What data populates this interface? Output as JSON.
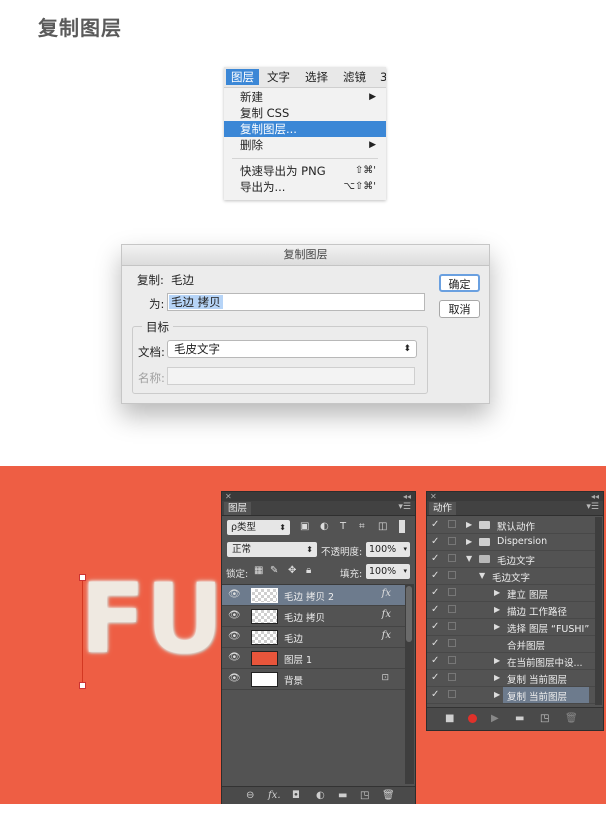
{
  "heading": "复制图层",
  "menu": {
    "bar": [
      "图层",
      "文字",
      "选择",
      "滤镜",
      "3"
    ],
    "items": [
      {
        "label": "新建",
        "shortcut": "",
        "arrow": "▶"
      },
      {
        "label": "复制 CSS",
        "shortcut": "",
        "arrow": ""
      },
      {
        "label": "复制图层...",
        "shortcut": "",
        "arrow": ""
      },
      {
        "label": "删除",
        "shortcut": "",
        "arrow": "▶"
      },
      {
        "label": "快速导出为 PNG",
        "shortcut": "⇧⌘'",
        "arrow": ""
      },
      {
        "label": "导出为...",
        "shortcut": "⌥⇧⌘'",
        "arrow": ""
      }
    ]
  },
  "dialog": {
    "title": "复制图层",
    "copy_label": "复制:",
    "copy_value": "毛边",
    "as_label": "为:",
    "as_value": "毛边 拷贝",
    "ok": "确定",
    "cancel": "取消",
    "target_label": "目标",
    "doc_label": "文档:",
    "doc_value": "毛皮文字",
    "name_label": "名称:",
    "name_value": ""
  },
  "canvas": {
    "background_color": "#ee5e44",
    "fur_text": "FU"
  },
  "layers_panel": {
    "tab": "图层",
    "filter_label": "ρ类型",
    "blend_mode": "正常",
    "opacity_label": "不透明度:",
    "opacity_value": "100%",
    "lock_label": "锁定:",
    "fill_label": "填充:",
    "fill_value": "100%",
    "layers": [
      {
        "name": "毛边 拷贝 2",
        "thumb": "checker",
        "fx": "fx",
        "selected": true
      },
      {
        "name": "毛边 拷贝",
        "thumb": "checker",
        "fx": "fx",
        "selected": false
      },
      {
        "name": "毛边",
        "thumb": "checker",
        "fx": "fx",
        "selected": false
      },
      {
        "name": "图层 1",
        "thumb": "#e8553b",
        "fx": "",
        "selected": false
      },
      {
        "name": "背景",
        "thumb": "#ffffff",
        "fx": "",
        "selected": false
      }
    ],
    "bottom_icons": [
      "link-icon",
      "fx-icon",
      "mask-icon",
      "adjustment-icon",
      "folder-icon",
      "new-layer-icon",
      "trash-icon"
    ],
    "bottom_fx": "fx."
  },
  "actions_panel": {
    "tab": "动作",
    "rows": [
      {
        "label": "默认动作",
        "level": 0,
        "expanded": false,
        "folder": true,
        "highlight": false
      },
      {
        "label": "Dispersion",
        "level": 0,
        "expanded": false,
        "folder": true,
        "highlight": false
      },
      {
        "label": "毛边文字",
        "level": 0,
        "expanded": true,
        "folder": true,
        "highlight": false
      },
      {
        "label": "毛边文字",
        "level": 1,
        "expanded": true,
        "folder": false,
        "highlight": false
      },
      {
        "label": "建立 图层",
        "level": 2,
        "expanded": false,
        "folder": false,
        "highlight": false
      },
      {
        "label": "描边 工作路径",
        "level": 2,
        "expanded": false,
        "folder": false,
        "highlight": false
      },
      {
        "label": "选择 图层 “FUSHI”",
        "level": 2,
        "expanded": false,
        "folder": false,
        "highlight": false
      },
      {
        "label": "合并图层",
        "level": 2,
        "expanded": null,
        "folder": false,
        "highlight": false
      },
      {
        "label": "在当前图层中设...",
        "level": 2,
        "expanded": false,
        "folder": false,
        "highlight": false
      },
      {
        "label": "复制 当前图层",
        "level": 2,
        "expanded": false,
        "folder": false,
        "highlight": false
      },
      {
        "label": "复制 当前图层",
        "level": 2,
        "expanded": false,
        "folder": false,
        "highlight": true
      }
    ],
    "bottom_icons": [
      "stop-icon",
      "record-icon",
      "play-icon",
      "folder-icon",
      "new-action-icon",
      "trash-icon"
    ]
  }
}
